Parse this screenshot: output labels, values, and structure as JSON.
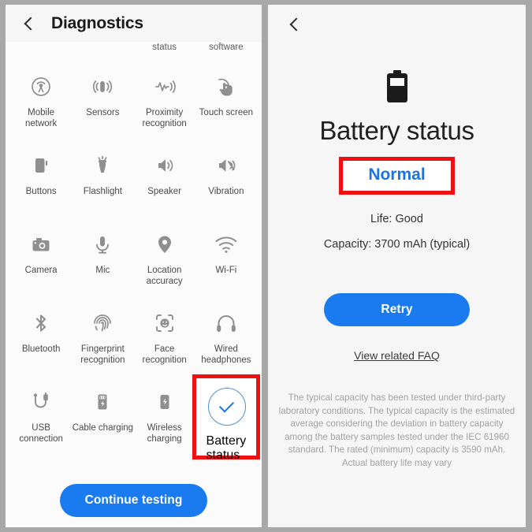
{
  "colors": {
    "accent_blue": "#1a7bf0",
    "link_blue": "#1a73e8",
    "highlight_red": "#ee1111",
    "panel_bg": "#f6f6f6",
    "page_bg": "#a8a8a8",
    "icon_gray": "#8f8f8f",
    "disabled_gray": "#b6b6b6"
  },
  "left_panel": {
    "header": {
      "back_icon": "chevron-left-icon",
      "title": "Diagnostics"
    },
    "cut_off_row": {
      "labels": [
        "",
        "",
        "status",
        "software"
      ]
    },
    "grid_items": [
      {
        "icon": "mobile-network-icon",
        "label": "Mobile\nnetwork",
        "state": "pending"
      },
      {
        "icon": "sensors-icon",
        "label": "Sensors",
        "state": "pending"
      },
      {
        "icon": "proximity-icon",
        "label": "Proximity\nrecognition",
        "state": "pending"
      },
      {
        "icon": "touch-screen-icon",
        "label": "Touch screen",
        "state": "pending"
      },
      {
        "icon": "buttons-icon",
        "label": "Buttons",
        "state": "pending"
      },
      {
        "icon": "flashlight-icon",
        "label": "Flashlight",
        "state": "pending"
      },
      {
        "icon": "speaker-icon",
        "label": "Speaker",
        "state": "pending"
      },
      {
        "icon": "vibration-icon",
        "label": "Vibration",
        "state": "pending"
      },
      {
        "icon": "camera-icon",
        "label": "Camera",
        "state": "pending"
      },
      {
        "icon": "mic-icon",
        "label": "Mic",
        "state": "pending"
      },
      {
        "icon": "location-icon",
        "label": "Location\naccuracy",
        "state": "pending"
      },
      {
        "icon": "wifi-icon",
        "label": "Wi-Fi",
        "state": "pending"
      },
      {
        "icon": "bluetooth-icon",
        "label": "Bluetooth",
        "state": "pending"
      },
      {
        "icon": "fingerprint-icon",
        "label": "Fingerprint\nrecognition",
        "state": "pending"
      },
      {
        "icon": "face-recognition-icon",
        "label": "Face\nrecognition",
        "state": "pending"
      },
      {
        "icon": "wired-headphones-icon",
        "label": "Wired\nheadphones",
        "state": "pending"
      },
      {
        "icon": "usb-connection-icon",
        "label": "USB\nconnection",
        "state": "pending"
      },
      {
        "icon": "cable-charging-icon",
        "label": "Cable charging",
        "state": "pending"
      },
      {
        "icon": "wireless-charging-icon",
        "label": "Wireless\ncharging",
        "state": "pending"
      },
      {
        "icon": "check-circle-icon",
        "label": "Battery\nstatus",
        "state": "done"
      }
    ],
    "footer": {
      "continue_label": "Continue testing"
    }
  },
  "right_panel": {
    "header": {
      "back_icon": "chevron-left-icon"
    },
    "battery_icon": "battery-icon",
    "title": "Battery status",
    "status": "Normal",
    "life": "Life: Good",
    "capacity": "Capacity: 3700 mAh (typical)",
    "retry_label": "Retry",
    "faq_label": "View related FAQ",
    "disclaimer": "The typical capacity has been tested under third-party laboratory conditions. The typical capacity is the estimated average considering the deviation in battery capacity among the battery samples tested under the IEC 61960 standard. The rated (minimum) capacity is 3590 mAh. Actual battery life may vary"
  }
}
